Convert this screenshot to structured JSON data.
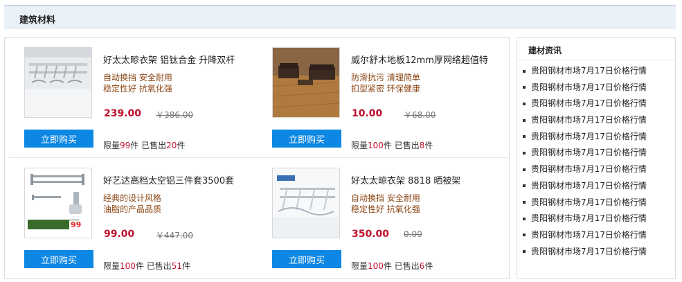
{
  "section": {
    "title": "建筑材料"
  },
  "products": [
    {
      "name": "好太太晾衣架 铝钛合金 升降双杆",
      "features": [
        "自动换挡 安全耐用",
        "稳定性好 抗氧化强"
      ],
      "price": "239.00",
      "old_price": "￥386.00",
      "buy_label": "立即购买",
      "stock_prefix": "限量",
      "limit": "99",
      "unit": "件",
      "sold_prefix": "已售出",
      "sold": "20",
      "sold_unit": "件",
      "thumb_icon": "clothes-rack-icon"
    },
    {
      "name": "威尔舒木地板12mm厚网络超值特",
      "features": [
        "防滑抗污 清理简单",
        "扣型紧密 环保健康"
      ],
      "price": "10.00",
      "old_price": "￥68.00",
      "buy_label": "立即购买",
      "stock_prefix": "限量",
      "limit": "100",
      "unit": "件",
      "sold_prefix": "已售出",
      "sold": "8",
      "sold_unit": "件",
      "thumb_icon": "wood-floor-room-icon"
    },
    {
      "name": "好艺达高档太空铝三件套3500套",
      "features": [
        "经典的设计风格",
        "油脂的产品品质"
      ],
      "price": "99.00",
      "old_price": "￥447.00",
      "buy_label": "立即购买",
      "stock_prefix": "限量",
      "limit": "100",
      "unit": "件",
      "sold_prefix": "已售出",
      "sold": "51",
      "sold_unit": "件",
      "thumb_icon": "towel-rack-set-icon",
      "thumb_badge": "99"
    },
    {
      "name": "好太太晾衣架 8818 晒被架",
      "features": [
        "自动换挡 安全耐用",
        "稳定性好 抗氧化强"
      ],
      "price": "350.00",
      "old_price": "0.00",
      "buy_label": "立即购买",
      "stock_prefix": "限量",
      "limit": "100",
      "unit": "件",
      "sold_prefix": "已售出",
      "sold": "6",
      "sold_unit": "件",
      "thumb_icon": "drying-rack-icon"
    }
  ],
  "news": {
    "title": "建材资讯",
    "items": [
      "贵阳钢材市场7月17日价格行情",
      "贵阳钢材市场7月17日价格行情",
      "贵阳钢材市场7月17日价格行情",
      "贵阳钢材市场7月17日价格行情",
      "贵阳钢材市场7月17日价格行情",
      "贵阳钢材市场7月17日价格行情",
      "贵阳钢材市场7月17日价格行情",
      "贵阳钢材市场7月17日价格行情",
      "贵阳钢材市场7月17日价格行情",
      "贵阳钢材市场7月17日价格行情",
      "贵阳钢材市场7月17日价格行情",
      "贵阳钢材市场7月17日价格行情"
    ]
  },
  "colors": {
    "accent": "#0c87e3",
    "price": "#c0102c",
    "feature": "#8b4513",
    "header_bg": "#eaf0f7"
  }
}
